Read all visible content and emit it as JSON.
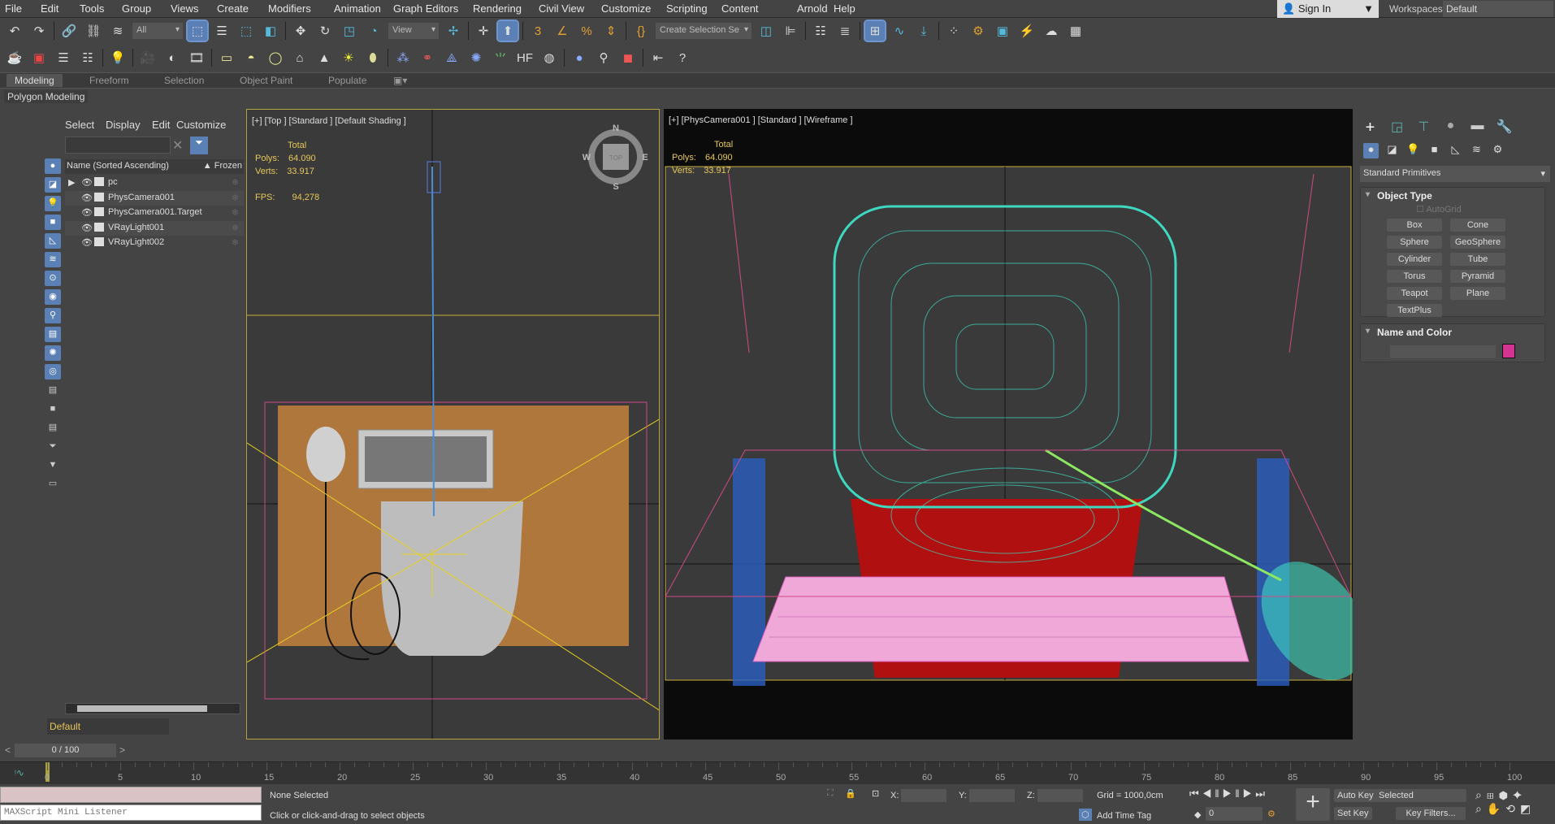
{
  "menu": [
    "File",
    "Edit",
    "Tools",
    "Group",
    "Views",
    "Create",
    "Modifiers",
    "Animation",
    "Graph Editors",
    "Rendering",
    "Civil View",
    "Customize",
    "Scripting",
    "Content",
    "Arnold",
    "Help"
  ],
  "signin": "Sign In",
  "workspaces": {
    "label": "Workspaces:",
    "value": "Default"
  },
  "toolbar1": {
    "filter": "All",
    "refcoord": "View",
    "selset": "Create Selection Se"
  },
  "ribbon": {
    "tabs": [
      "Modeling",
      "Freeform",
      "Selection",
      "Object Paint",
      "Populate"
    ],
    "panel": "Polygon Modeling"
  },
  "explorer": {
    "menu": [
      "Select",
      "Display",
      "Edit",
      "Customize"
    ],
    "col_name": "Name (Sorted Ascending)",
    "col_frozen": "Frozen",
    "rows": [
      "pc",
      "PhysCamera001",
      "PhysCamera001.Target",
      "VRayLight001",
      "VRayLight002"
    ],
    "layer": "Default"
  },
  "viewport_top": {
    "label": "[+] [Top ] [Standard ] [Default Shading ]",
    "total": "Total",
    "polys_label": "Polys:",
    "polys": "64.090",
    "verts_label": "Verts:",
    "verts": "33.917",
    "fps_label": "FPS:",
    "fps": "94,278",
    "compass": [
      "N",
      "S",
      "E",
      "W"
    ],
    "cube": "TOP"
  },
  "viewport_cam": {
    "label": "[+] [PhysCamera001 ] [Standard ] [Wireframe ]",
    "total": "Total",
    "polys_label": "Polys:",
    "polys": "64.090",
    "verts_label": "Verts:",
    "verts": "33.917"
  },
  "command_panel": {
    "category": "Standard Primitives",
    "object_type": "Object Type",
    "autogrid": "AutoGrid",
    "buttons": [
      "Box",
      "Cone",
      "Sphere",
      "GeoSphere",
      "Cylinder",
      "Tube",
      "Torus",
      "Pyramid",
      "Teapot",
      "Plane",
      "TextPlus"
    ],
    "name_color": "Name and Color",
    "color": "#d4338f"
  },
  "time": {
    "frame": "0 / 100",
    "ticks": [
      "0",
      "5",
      "10",
      "15",
      "20",
      "25",
      "30",
      "35",
      "40",
      "45",
      "50",
      "55",
      "60",
      "65",
      "70",
      "75",
      "80",
      "85",
      "90",
      "95",
      "100"
    ]
  },
  "status": {
    "maxscript": "MAXScript Mini Listener",
    "selection": "None Selected",
    "prompt": "Click or click-and-drag to select objects",
    "x": "X:",
    "y": "Y:",
    "z": "Z:",
    "grid": "Grid = 1000,0cm",
    "add_time_tag": "Add Time Tag",
    "auto_key": "Auto Key",
    "set_key": "Set Key",
    "key_mode": "Selected",
    "key_filters": "Key Filters...",
    "current_frame": "0"
  }
}
